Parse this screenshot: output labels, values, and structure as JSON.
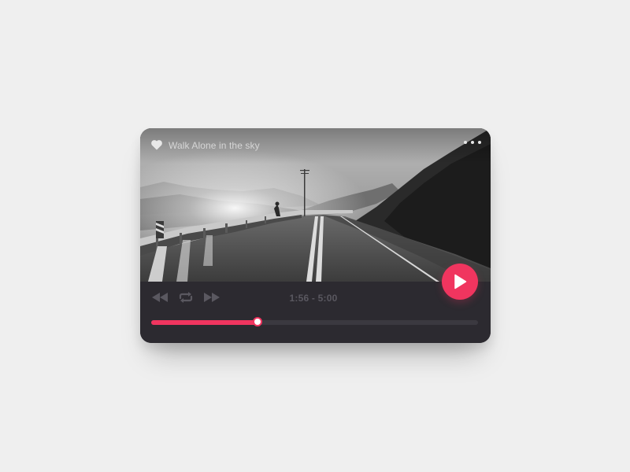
{
  "player": {
    "title": "Walk Alone in the sky",
    "time": "1:56 - 5:00",
    "progress_fraction": 0.325,
    "favorite": true
  },
  "icons": {
    "favorite": "heart-icon",
    "menu": "more-dots-icon",
    "rewind": "rewind-icon",
    "repeat": "repeat-icon",
    "forward": "fast-forward-icon",
    "play": "play-icon"
  },
  "colors": {
    "accent": "#f0355f",
    "player_background": "#2c2a30",
    "track_background": "#3b3940",
    "muted_controls": "#5a5860",
    "page_background": "#efefef"
  }
}
